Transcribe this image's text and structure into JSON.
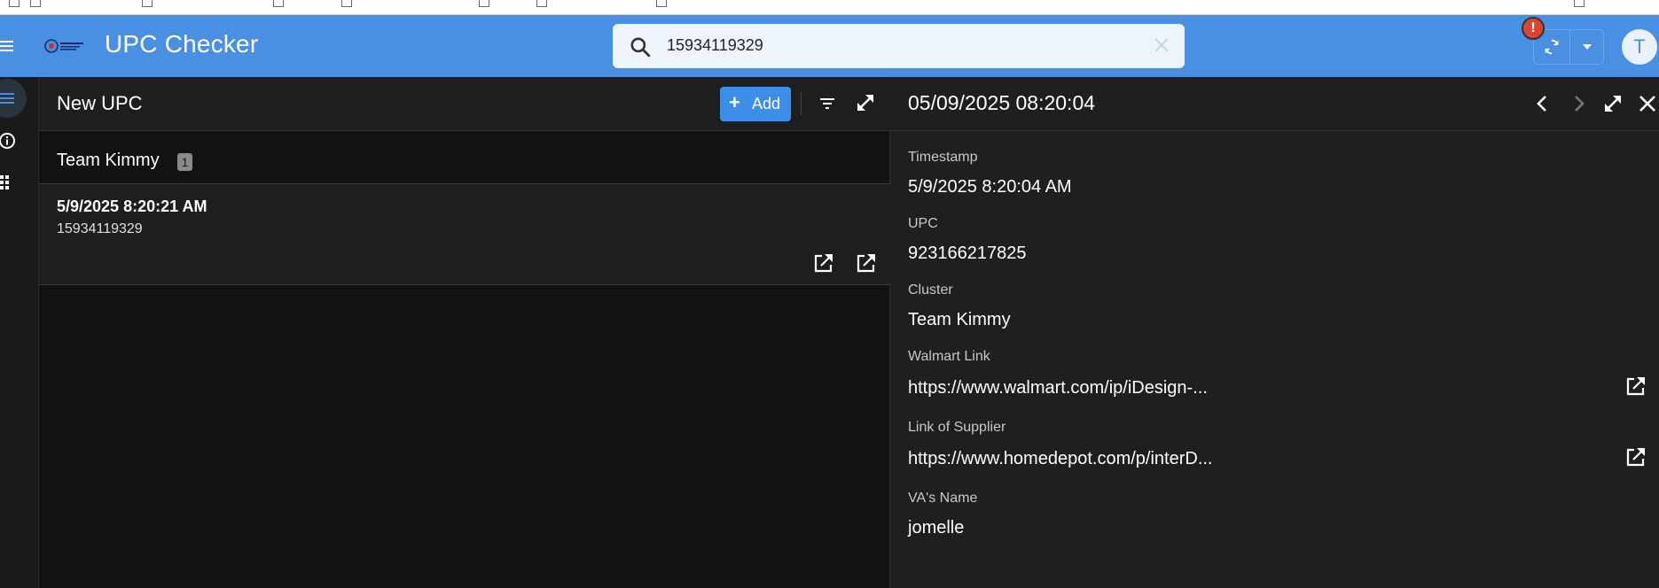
{
  "app": {
    "title": "UPC Checker"
  },
  "search": {
    "value": "15934119329"
  },
  "header_actions": {
    "alert_symbol": "!",
    "avatar_initial": "T"
  },
  "rail": {
    "items": [
      "menu-icon",
      "info-icon",
      "apps-icon"
    ]
  },
  "list_view": {
    "title": "New UPC",
    "add_label": "Add",
    "group": {
      "name": "Team Kimmy",
      "count": "1"
    },
    "records": [
      {
        "timestamp": "5/9/2025 8:20:21 AM",
        "upc": "15934119329"
      }
    ]
  },
  "detail": {
    "title": "05/09/2025 08:20:04",
    "fields": {
      "timestamp": {
        "label": "Timestamp",
        "value": "5/9/2025 8:20:04 AM"
      },
      "upc": {
        "label": "UPC",
        "value": "923166217825"
      },
      "cluster": {
        "label": "Cluster",
        "value": "Team Kimmy"
      },
      "walmart_link": {
        "label": "Walmart Link",
        "value": "https://www.walmart.com/ip/iDesign-..."
      },
      "supplier_link": {
        "label": "Link of Supplier",
        "value": "https://www.homedepot.com/p/interD..."
      },
      "va_name": {
        "label": "VA's Name",
        "value": "jomelle"
      }
    }
  },
  "colors": {
    "app_bar": "#4a90e2",
    "accent": "#3d8ee8",
    "background": "#121212",
    "panel": "#1f1f1f",
    "alert": "#d9462f"
  }
}
